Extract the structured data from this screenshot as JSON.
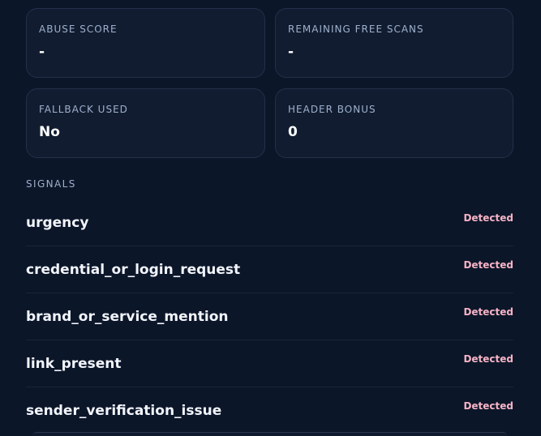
{
  "stats": [
    {
      "label": "ABUSE SCORE",
      "value": "-"
    },
    {
      "label": "REMAINING FREE SCANS",
      "value": "-"
    },
    {
      "label": "FALLBACK USED",
      "value": "No"
    },
    {
      "label": "HEADER BONUS",
      "value": "0"
    }
  ],
  "signals": {
    "heading": "SIGNALS",
    "items": [
      {
        "name": "urgency",
        "status": "Detected"
      },
      {
        "name": "credential_or_login_request",
        "status": "Detected"
      },
      {
        "name": "brand_or_service_mention",
        "status": "Detected"
      },
      {
        "name": "link_present",
        "status": "Detected"
      },
      {
        "name": "sender_verification_issue",
        "status": "Detected"
      }
    ]
  },
  "colors": {
    "background": "#0c1629",
    "card_background": "#111c30",
    "label": "#9fb0cc",
    "detected_badge": "#f7b4c6"
  }
}
